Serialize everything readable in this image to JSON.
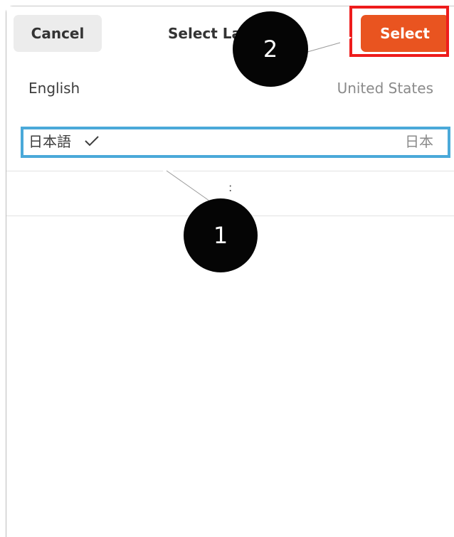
{
  "header": {
    "cancel_label": "Cancel",
    "title": "Select La",
    "select_label": "Select"
  },
  "languages": [
    {
      "name": "English",
      "region": "United States",
      "selected": false
    },
    {
      "name": "日本語",
      "region": "日本",
      "selected": true
    }
  ],
  "more_indicator": ":",
  "annotations": {
    "step1": "1",
    "step2": "2"
  },
  "colors": {
    "accent": "#e95420",
    "highlight_blue": "#4aa9d9",
    "highlight_red": "#ee1c1c",
    "marker": "#050505"
  }
}
